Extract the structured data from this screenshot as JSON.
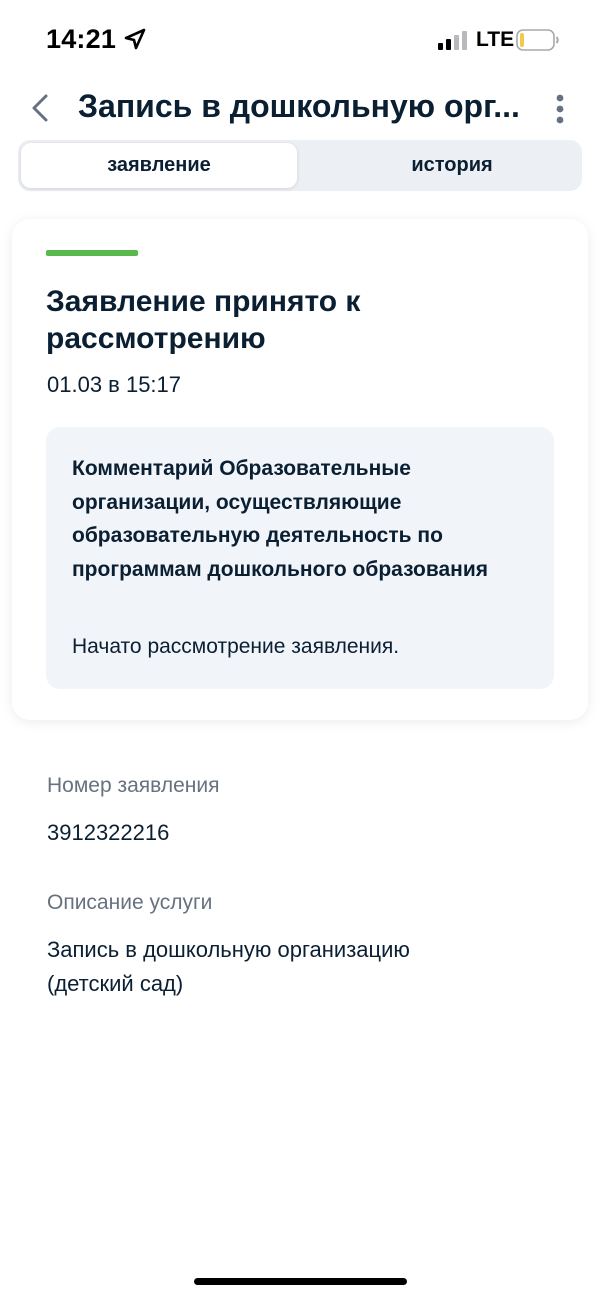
{
  "status_bar": {
    "time": "14:21",
    "network": "LTE"
  },
  "header": {
    "title": "Запись в дошкольную орг...",
    "back_icon": "chevron-left-icon",
    "more_icon": "vertical-dots-icon"
  },
  "tabs": [
    {
      "label": "заявление",
      "active": true
    },
    {
      "label": "история",
      "active": false
    }
  ],
  "status_card": {
    "accent_color": "#5ab94d",
    "title_line1": "Заявление принято к",
    "title_line2": "рассмотрению",
    "date": "01.03 в 15:17",
    "comment": {
      "title": "Комментарий Образовательные организации, осуществляющие образовательную деятельность по программам дошкольного образования",
      "text": "Начато рассмотрение заявления."
    }
  },
  "details": {
    "number_label": "Номер заявления",
    "number_value": "3912322216",
    "description_label": "Описание услуги",
    "description_line1": "Запись в дошкольную организацию",
    "description_line2": "(детский сад)"
  }
}
